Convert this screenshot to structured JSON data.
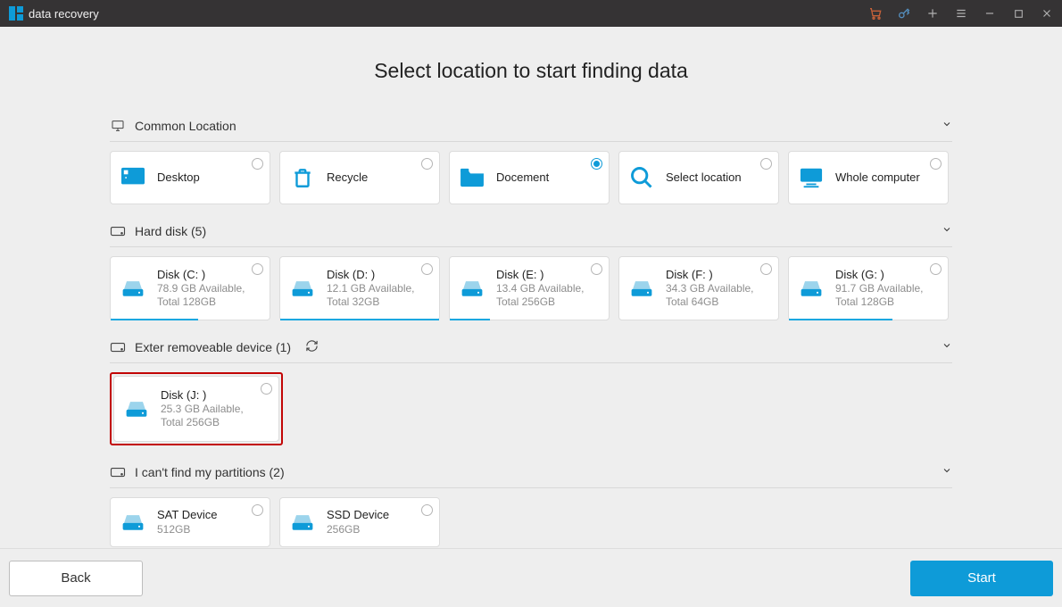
{
  "window": {
    "title": "data recovery"
  },
  "page_title": "Select location to  start finding data",
  "sections": {
    "common": {
      "header": "Common Location",
      "items": [
        {
          "label": "Desktop",
          "selected": false
        },
        {
          "label": "Recycle",
          "selected": false
        },
        {
          "label": "Docement",
          "selected": true
        },
        {
          "label": "Select location",
          "selected": false
        },
        {
          "label": "Whole computer",
          "selected": false
        }
      ]
    },
    "hard": {
      "header": "Hard disk (5)",
      "items": [
        {
          "label": "Disk (C: )",
          "sub1": "78.9 GB Available,",
          "sub2": "Total 128GB",
          "fill": 55
        },
        {
          "label": "Disk (D: )",
          "sub1": "12.1 GB Available,",
          "sub2": "Total 32GB",
          "fill": 100
        },
        {
          "label": "Disk (E: )",
          "sub1": "13.4 GB Available,",
          "sub2": "Total 256GB",
          "fill": 25
        },
        {
          "label": "Disk (F: )",
          "sub1": "34.3 GB Available,",
          "sub2": "Total 64GB",
          "fill": 0
        },
        {
          "label": "Disk (G: )",
          "sub1": "91.7 GB Available,",
          "sub2": "Total 128GB",
          "fill": 65
        }
      ]
    },
    "removable": {
      "header": "Exter removeable device (1)",
      "items": [
        {
          "label": "Disk (J: )",
          "sub1": "25.3 GB Aailable,",
          "sub2": "Total 256GB"
        }
      ]
    },
    "cant_find": {
      "header": "I can't find my partitions (2)",
      "items": [
        {
          "label": "SAT Device",
          "sub": "512GB"
        },
        {
          "label": "SSD Device",
          "sub": "256GB"
        }
      ]
    }
  },
  "footer": {
    "back": "Back",
    "start": "Start"
  }
}
